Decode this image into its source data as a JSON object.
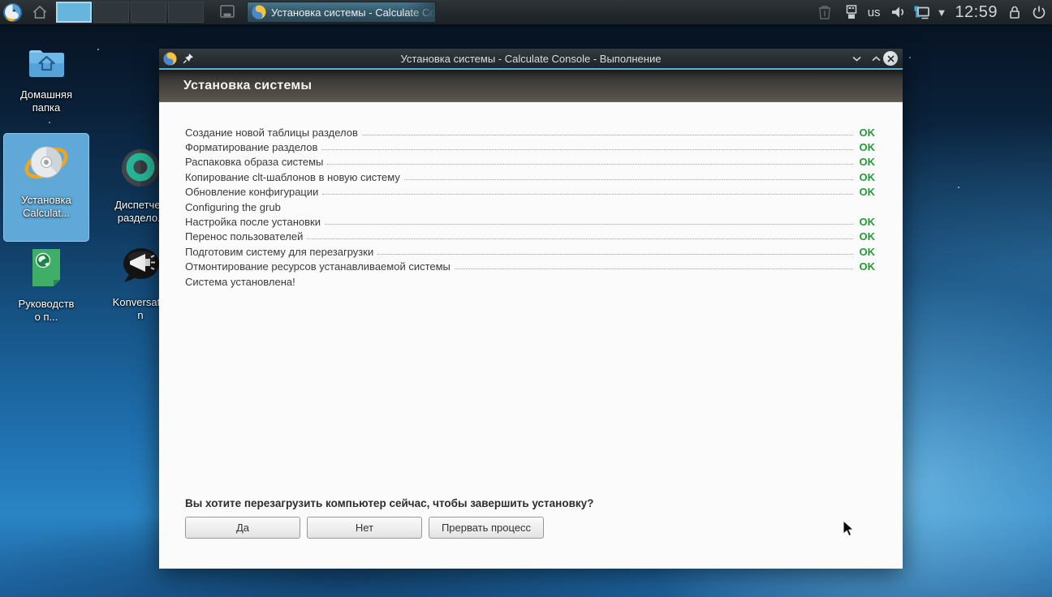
{
  "taskbar": {
    "pager_desktops": 4,
    "pager_active_index": 0,
    "task_button_label": "Установка системы - Calculate Co",
    "tray": {
      "keyboard_layout": "us",
      "clock": "12:59",
      "icon_names": [
        "trash-icon",
        "device-notifier-icon",
        "volume-icon",
        "network-icon",
        "tray-expander-icon",
        "lock-icon",
        "power-icon"
      ]
    }
  },
  "desktop_icons": [
    {
      "id": "home-folder",
      "icon": "home-folder-icon",
      "lines": [
        "Домашняя",
        "папка"
      ],
      "selected": false
    },
    {
      "id": "install-calculate",
      "icon": "calculate-cd-icon",
      "lines": [
        "Установка",
        "Calculat..."
      ],
      "selected": true
    },
    {
      "id": "partition-manager",
      "icon": "partition-manager-icon",
      "lines": [
        "Диспетчер",
        "раздело.."
      ],
      "selected": false
    },
    {
      "id": "handbook",
      "icon": "handbook-icon",
      "lines": [
        "Руководств",
        "о п..."
      ],
      "selected": false
    },
    {
      "id": "konversation",
      "icon": "konversation-icon",
      "lines": [
        "Konversatio",
        "n"
      ],
      "selected": false
    }
  ],
  "window": {
    "titlebar_title": "Установка системы - Calculate Console - Выполнение",
    "header_title": "Установка системы",
    "tasks": [
      {
        "label": "Создание новой таблицы разделов",
        "status": "OK"
      },
      {
        "label": "Форматирование разделов",
        "status": "OK"
      },
      {
        "label": "Распаковка образа системы",
        "status": "OK"
      },
      {
        "label": "Копирование clt-шаблонов в новую систему",
        "status": "OK"
      },
      {
        "label": "Обновление конфигурации",
        "status": "OK"
      },
      {
        "label": "Configuring the grub",
        "status": ""
      },
      {
        "label": "Настройка после установки",
        "status": "OK"
      },
      {
        "label": "Перенос пользователей",
        "status": "OK"
      },
      {
        "label": "Подготовим систему для перезагрузки",
        "status": "OK"
      },
      {
        "label": "Отмонтирование ресурсов устанавливаемой системы",
        "status": "OK"
      },
      {
        "label": "Система установлена!",
        "status": ""
      }
    ],
    "question": "Вы хотите перезагрузить компьютер сейчас, чтобы завершить установку?",
    "buttons": [
      "Да",
      "Нет",
      "Прервать процесс"
    ]
  },
  "colors": {
    "ok_green": "#229a36",
    "titlebar_accent": "#55b7dc",
    "selection_blue": "#5fa8d7",
    "taskbar_bg": "#23282c"
  }
}
